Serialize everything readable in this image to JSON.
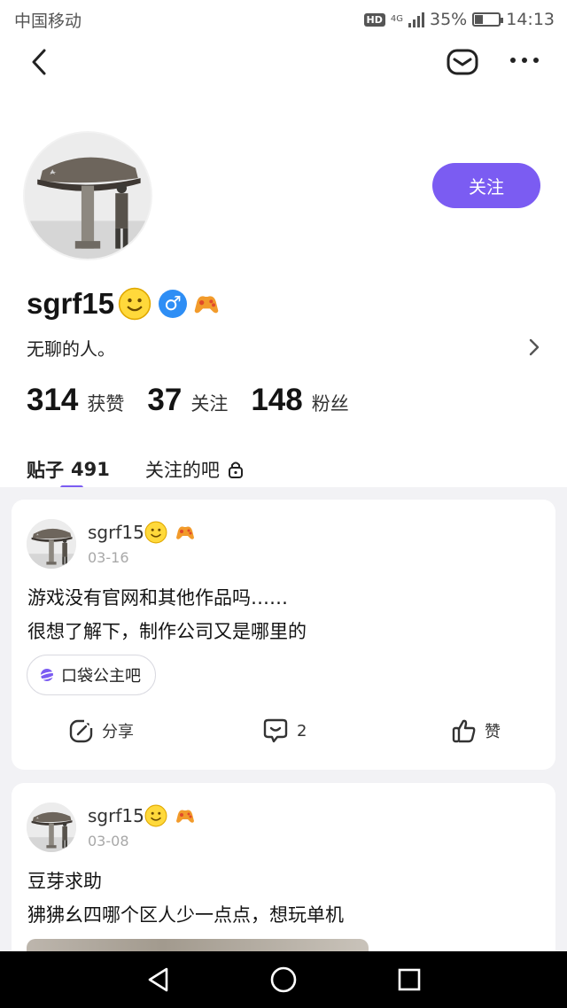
{
  "status_bar": {
    "carrier": "中国移动",
    "hd": "HD",
    "network": "4G",
    "battery": "35%",
    "battery_level": 0.35,
    "time": "14:13"
  },
  "profile": {
    "username": "sgrf15",
    "bio": "无聊的人。",
    "follow_label": "关注",
    "stats": [
      {
        "value": "314",
        "label": "获赞"
      },
      {
        "value": "37",
        "label": "关注"
      },
      {
        "value": "148",
        "label": "粉丝"
      }
    ]
  },
  "tabs": [
    {
      "label": "贴子",
      "count": "491"
    },
    {
      "label": "关注的吧"
    }
  ],
  "posts": [
    {
      "author": "sgrf15",
      "date": "03-16",
      "lines": [
        "游戏没有官网和其他作品吗……",
        "很想了解下，制作公司又是哪里的"
      ],
      "forum": "口袋公主吧",
      "share_label": "分享",
      "comment_count": "2",
      "like_label": "赞"
    },
    {
      "author": "sgrf15",
      "date": "03-08",
      "lines": [
        "豆芽求助",
        "狒狒幺四哪个区人少一点点，想玩单机"
      ]
    }
  ],
  "colors": {
    "accent": "#7b5cf2",
    "male_badge": "#2e8ef5",
    "feed_bg": "#f2f2f5"
  },
  "icons": {
    "back": "chevron-left-icon",
    "mail": "mail-icon",
    "more": "more-icon",
    "lock": "lock-icon",
    "share": "share-icon",
    "comment": "comment-icon",
    "like": "thumbs-up-icon"
  }
}
